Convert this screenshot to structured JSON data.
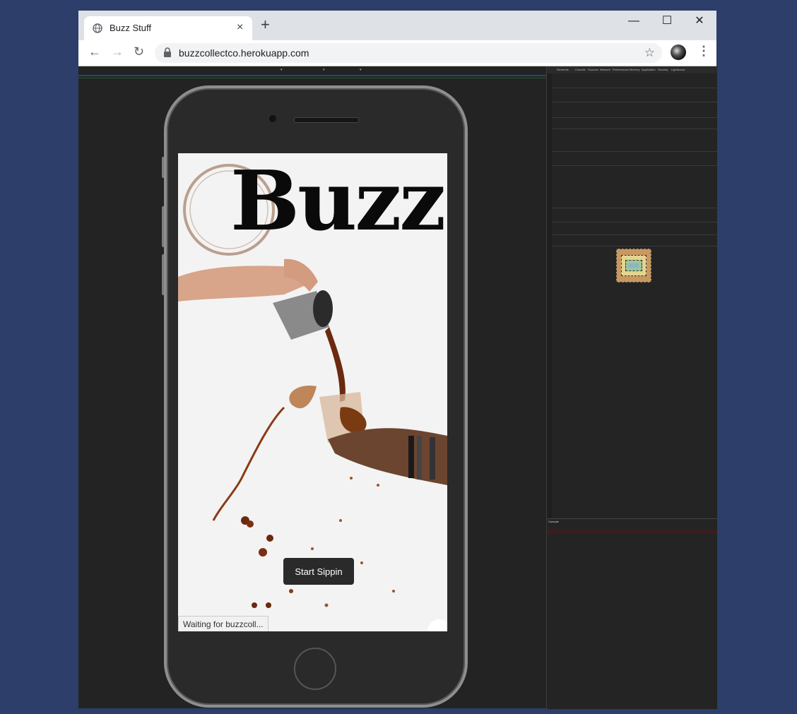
{
  "browser": {
    "tab_title": "Buzz Stuff",
    "tab_close": "×",
    "new_tab": "+",
    "url": "buzzcollectco.herokuapp.com",
    "minimize": "—",
    "maximize": "☐",
    "close": "✕",
    "back": "←",
    "forward": "→",
    "reload": "↻",
    "bookmark": "☆",
    "menu": "⋮"
  },
  "app": {
    "logo": "Buzz",
    "cta_label": "Start Sippin",
    "status_text": "Waiting for buzzcoll..."
  },
  "devtools": {
    "tabs": [
      "Elements",
      "Console",
      "Sources",
      "Network",
      "Performance",
      "Memory",
      "Application",
      "Security",
      "Lighthouse"
    ],
    "console_tab": "Console"
  },
  "colors": {
    "desktop_bg": "#2c3e69",
    "cta_bg": "#2a2a2a"
  }
}
